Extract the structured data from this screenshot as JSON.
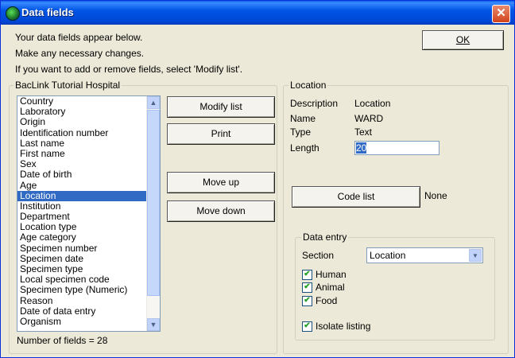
{
  "window": {
    "title": "Data fields",
    "close_glyph": "✕"
  },
  "intro": {
    "line1": "Your data fields appear below.",
    "line2": "Make any necessary changes.",
    "line3": "If you want to add or remove fields, select 'Modify list'."
  },
  "ok_button": "OK",
  "fields_group": {
    "label": "BacLink Tutorial Hospital",
    "items": [
      "Country",
      "Laboratory",
      "Origin",
      "Identification number",
      "Last name",
      "First name",
      "Sex",
      "Date of birth",
      "Age",
      "Location",
      "Institution",
      "Department",
      "Location type",
      "Age category",
      "Specimen number",
      "Specimen date",
      "Specimen type",
      "Local specimen code",
      "Specimen type (Numeric)",
      "Reason",
      "Date of data entry",
      "Organism"
    ],
    "selected": "Location",
    "count_text": "Number of fields = 28"
  },
  "buttons": {
    "modify_list": "Modify list",
    "print": "Print",
    "move_up": "Move up",
    "move_down": "Move down"
  },
  "location_group": {
    "label": "Location",
    "description_label": "Description",
    "description_value": "Location",
    "name_label": "Name",
    "name_value": "WARD",
    "type_label": "Type",
    "type_value": "Text",
    "length_label": "Length",
    "length_value": "20",
    "code_list_button": "Code list",
    "code_list_value": "None"
  },
  "data_entry": {
    "label": "Data entry",
    "section_label": "Section",
    "section_value": "Location",
    "human_label": "Human",
    "animal_label": "Animal",
    "food_label": "Food",
    "isolate_label": "Isolate listing",
    "human_checked": true,
    "animal_checked": true,
    "food_checked": true,
    "isolate_checked": true
  },
  "icons": {
    "app": "globe-icon",
    "close": "close-icon",
    "scroll_up": "scroll-up-arrow-icon",
    "scroll_down": "scroll-down-arrow-icon",
    "dropdown": "dropdown-arrow-icon"
  }
}
